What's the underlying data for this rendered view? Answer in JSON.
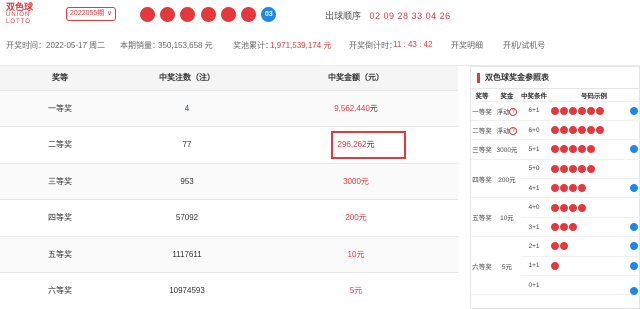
{
  "header": {
    "logo": {
      "line1": "双色球",
      "line2": "UNION",
      "line3": "LOTTO"
    },
    "issue": "2022055期",
    "red_balls": [
      "02",
      "04",
      "09",
      "26",
      "28",
      "33"
    ],
    "blue_ball": "03",
    "order_label": "出球顺序",
    "order_numbers": "02  09  28  33  04  26"
  },
  "info": {
    "open_time": "开奖时间：2022-05-17 周二",
    "sales_label": "本期销量：",
    "sales_value": "350,153,658 元",
    "pool_label": "奖池累计：",
    "pool_value": "1,971,539,174 元",
    "countdown_label": "开奖倒计时：",
    "countdown_value": "11 : 43 : 42",
    "detail_link": "开奖明细",
    "machine_link": "开机/试机号"
  },
  "prize_table": {
    "headers": [
      "奖等",
      "中奖注数（注）",
      "中奖金额（元）"
    ],
    "rows": [
      {
        "level": "一等奖",
        "count": "4",
        "amount": "9,562,440",
        "unit": "元"
      },
      {
        "level": "二等奖",
        "count": "77",
        "amount": "296,262",
        "unit": "元"
      },
      {
        "level": "三等奖",
        "count": "953",
        "amount": "3000",
        "unit": "元"
      },
      {
        "level": "四等奖",
        "count": "57092",
        "amount": "200",
        "unit": "元"
      },
      {
        "level": "五等奖",
        "count": "1117611",
        "amount": "10",
        "unit": "元"
      },
      {
        "level": "六等奖",
        "count": "10974593",
        "amount": "5",
        "unit": "元"
      }
    ]
  },
  "rules_panel": {
    "title": "双色球奖金参照表",
    "headers": [
      "奖等",
      "奖金",
      "中奖条件",
      "号码示例"
    ],
    "float_label": "浮动",
    "rows": [
      {
        "level": "一等奖",
        "prize": "浮动",
        "cond": "6+1"
      },
      {
        "level": "二等奖",
        "prize": "浮动",
        "cond": "6+0"
      },
      {
        "level": "三等奖",
        "prize": "3000元",
        "cond": "5+1"
      },
      {
        "level": "四等奖",
        "prize": "200元",
        "cond": "5+0"
      },
      {
        "level": "",
        "prize": "",
        "cond": "4+1"
      },
      {
        "level": "五等奖",
        "prize": "10元",
        "cond": "4+0"
      },
      {
        "level": "",
        "prize": "",
        "cond": "3+1"
      },
      {
        "level": "六等奖",
        "prize": "5元",
        "cond": "2+1"
      },
      {
        "level": "",
        "prize": "",
        "cond": "1+1"
      },
      {
        "level": "",
        "prize": "",
        "cond": "0+1"
      }
    ]
  },
  "colors": {
    "accent": "#e4393c",
    "blue": "#1e88e5"
  }
}
